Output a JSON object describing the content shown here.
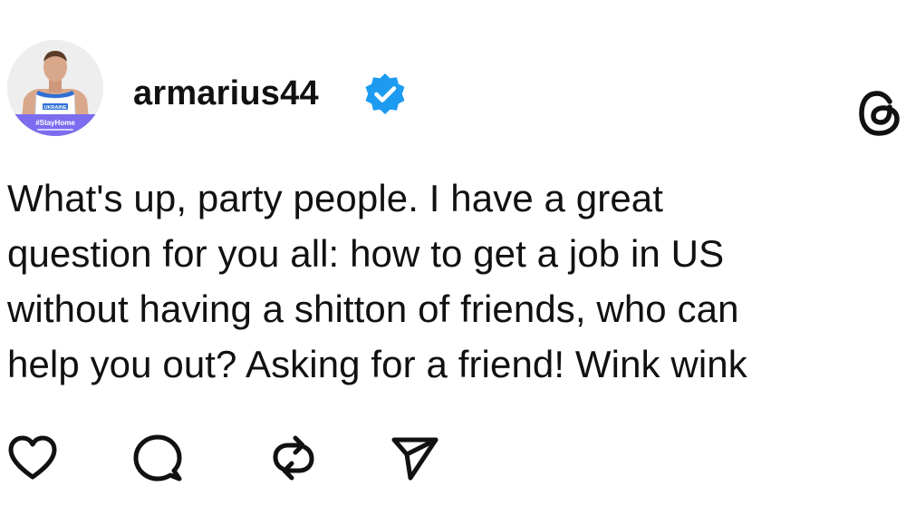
{
  "post": {
    "username": "armarius44",
    "verified": true,
    "body": "What's up, party people. I have a great\nquestion for you all: how to get a job in US\nwithout having a shitton of friends, who can\nhelp you out? Asking for a friend! Wink wink",
    "avatar": {
      "jersey_text": "UKRAINE",
      "banner_text": "#StayHome",
      "banner_color": "#7b6cf0"
    }
  },
  "icons": {
    "brand": "threads-logo-icon",
    "verified": "verified-badge-icon",
    "like": "heart-icon",
    "comment": "comment-bubble-icon",
    "repost": "repost-icon",
    "share": "send-icon"
  },
  "colors": {
    "verified": "#1d9bf0",
    "text": "#111111",
    "background": "#ffffff"
  }
}
